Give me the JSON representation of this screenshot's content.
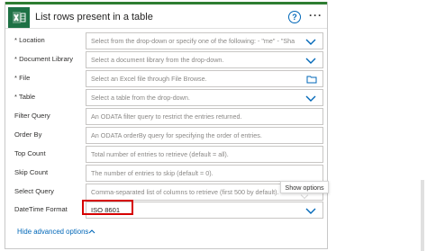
{
  "header": {
    "title": "List rows present in a table",
    "help_glyph": "?",
    "more_glyph": "···"
  },
  "fields": [
    {
      "label": "* Location",
      "text": "Select from the drop-down or specify one of the following: - \"me\" - \"Sha",
      "control": "dropdown"
    },
    {
      "label": "* Document Library",
      "text": "Select a document library from the drop-down.",
      "control": "dropdown"
    },
    {
      "label": "* File",
      "text": "Select an Excel file through File Browse.",
      "control": "file"
    },
    {
      "label": "* Table",
      "text": "Select a table from the drop-down.",
      "control": "dropdown"
    },
    {
      "label": "Filter Query",
      "text": "An ODATA filter query to restrict the entries returned.",
      "control": "text"
    },
    {
      "label": "Order By",
      "text": "An ODATA orderBy query for specifying the order of entries.",
      "control": "text"
    },
    {
      "label": "Top Count",
      "text": "Total number of entries to retrieve (default = all).",
      "control": "text"
    },
    {
      "label": "Skip Count",
      "text": "The number of entries to skip (default = 0).",
      "control": "text"
    },
    {
      "label": "Select Query",
      "text": "Comma-separated list of columns to retrieve (first 500 by default).",
      "control": "text"
    },
    {
      "label": "DateTime Format",
      "text": "ISO 8601",
      "control": "dropdown",
      "has_value": true
    }
  ],
  "tooltip": {
    "text": "Show options"
  },
  "advanced": {
    "label": "Hide advanced options"
  },
  "colors": {
    "accent": "#2e7d32",
    "link": "#0067b8",
    "highlight": "#d60000",
    "excel_green": "#1e7145"
  },
  "icons": {
    "app": "excel-icon",
    "help": "help-icon",
    "more": "more-options-icon",
    "dropdown": "chevron-down-icon",
    "file": "folder-icon",
    "advanced": "chevron-up-icon"
  }
}
